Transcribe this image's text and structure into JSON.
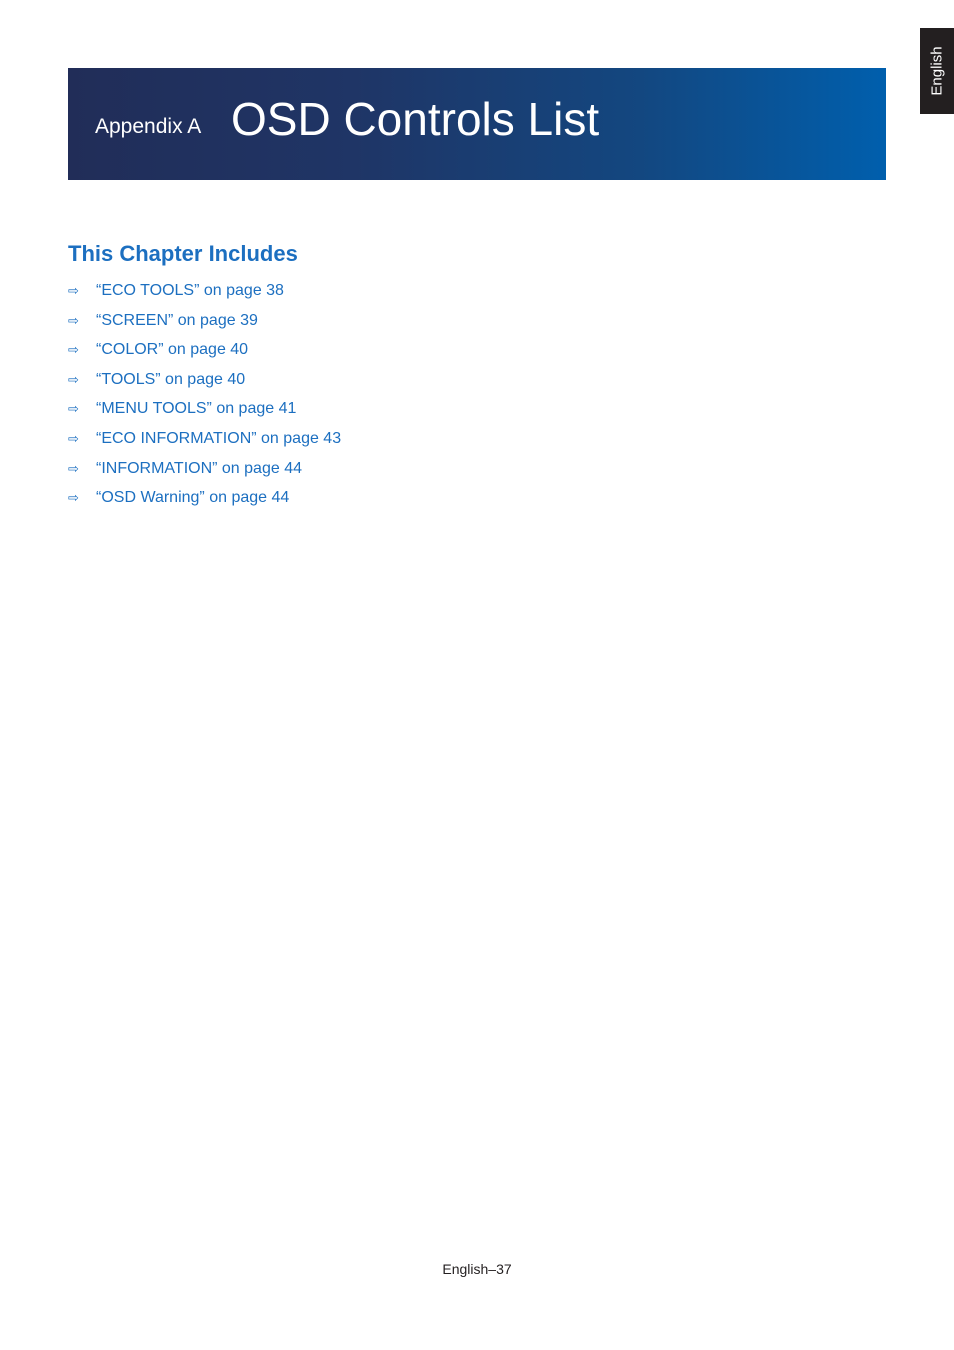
{
  "language_tab": {
    "label": "English"
  },
  "banner": {
    "appendix_label": "Appendix A",
    "title": "OSD Controls List"
  },
  "section": {
    "heading": "This Chapter Includes",
    "items": [
      {
        "icon": "arrow-right-icon",
        "label": "“ECO TOOLS” on page 38"
      },
      {
        "icon": "arrow-right-icon",
        "label": "“SCREEN” on page 39"
      },
      {
        "icon": "arrow-right-icon",
        "label": "“COLOR” on page 40"
      },
      {
        "icon": "arrow-right-icon",
        "label": "“TOOLS” on page 40"
      },
      {
        "icon": "arrow-right-icon",
        "label": "“MENU TOOLS” on page 41"
      },
      {
        "icon": "arrow-right-icon",
        "label": "“ECO INFORMATION” on page 43"
      },
      {
        "icon": "arrow-right-icon",
        "label": "“INFORMATION” on page 44"
      },
      {
        "icon": "arrow-right-icon",
        "label": "“OSD Warning” on page 44"
      }
    ]
  },
  "footer": {
    "page_label": "English–37"
  },
  "colors": {
    "link_blue": "#1c6fc0",
    "banner_start": "#212d58",
    "banner_end": "#005fad",
    "tab_bg": "#231f20"
  }
}
